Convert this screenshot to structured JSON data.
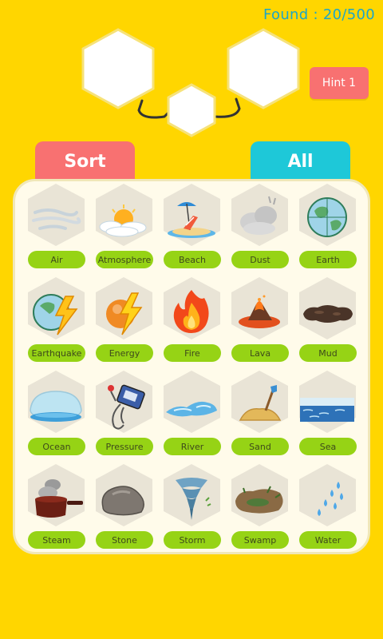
{
  "header": {
    "found_text": "Found : 20/500",
    "hint_label": "Hint 1"
  },
  "tabs": {
    "sort_label": "Sort",
    "all_label": "All"
  },
  "colors": {
    "background": "#FFD600",
    "tab_sort": "#F87171",
    "tab_all": "#1EC8D8",
    "label_pill": "#96D315",
    "found_text": "#1BA6C9"
  },
  "elements": [
    {
      "label": "Air",
      "icon": "air-icon"
    },
    {
      "label": "Atmosphere",
      "icon": "atmosphere-icon"
    },
    {
      "label": "Beach",
      "icon": "beach-icon"
    },
    {
      "label": "Dust",
      "icon": "dust-icon"
    },
    {
      "label": "Earth",
      "icon": "earth-icon"
    },
    {
      "label": "Earthquake",
      "icon": "earthquake-icon"
    },
    {
      "label": "Energy",
      "icon": "energy-icon"
    },
    {
      "label": "Fire",
      "icon": "fire-icon"
    },
    {
      "label": "Lava",
      "icon": "lava-icon"
    },
    {
      "label": "Mud",
      "icon": "mud-icon"
    },
    {
      "label": "Ocean",
      "icon": "ocean-icon"
    },
    {
      "label": "Pressure",
      "icon": "pressure-icon"
    },
    {
      "label": "River",
      "icon": "river-icon"
    },
    {
      "label": "Sand",
      "icon": "sand-icon"
    },
    {
      "label": "Sea",
      "icon": "sea-icon"
    },
    {
      "label": "Steam",
      "icon": "steam-icon"
    },
    {
      "label": "Stone",
      "icon": "stone-icon"
    },
    {
      "label": "Storm",
      "icon": "storm-icon"
    },
    {
      "label": "Swamp",
      "icon": "swamp-icon"
    },
    {
      "label": "Water",
      "icon": "water-icon"
    }
  ]
}
